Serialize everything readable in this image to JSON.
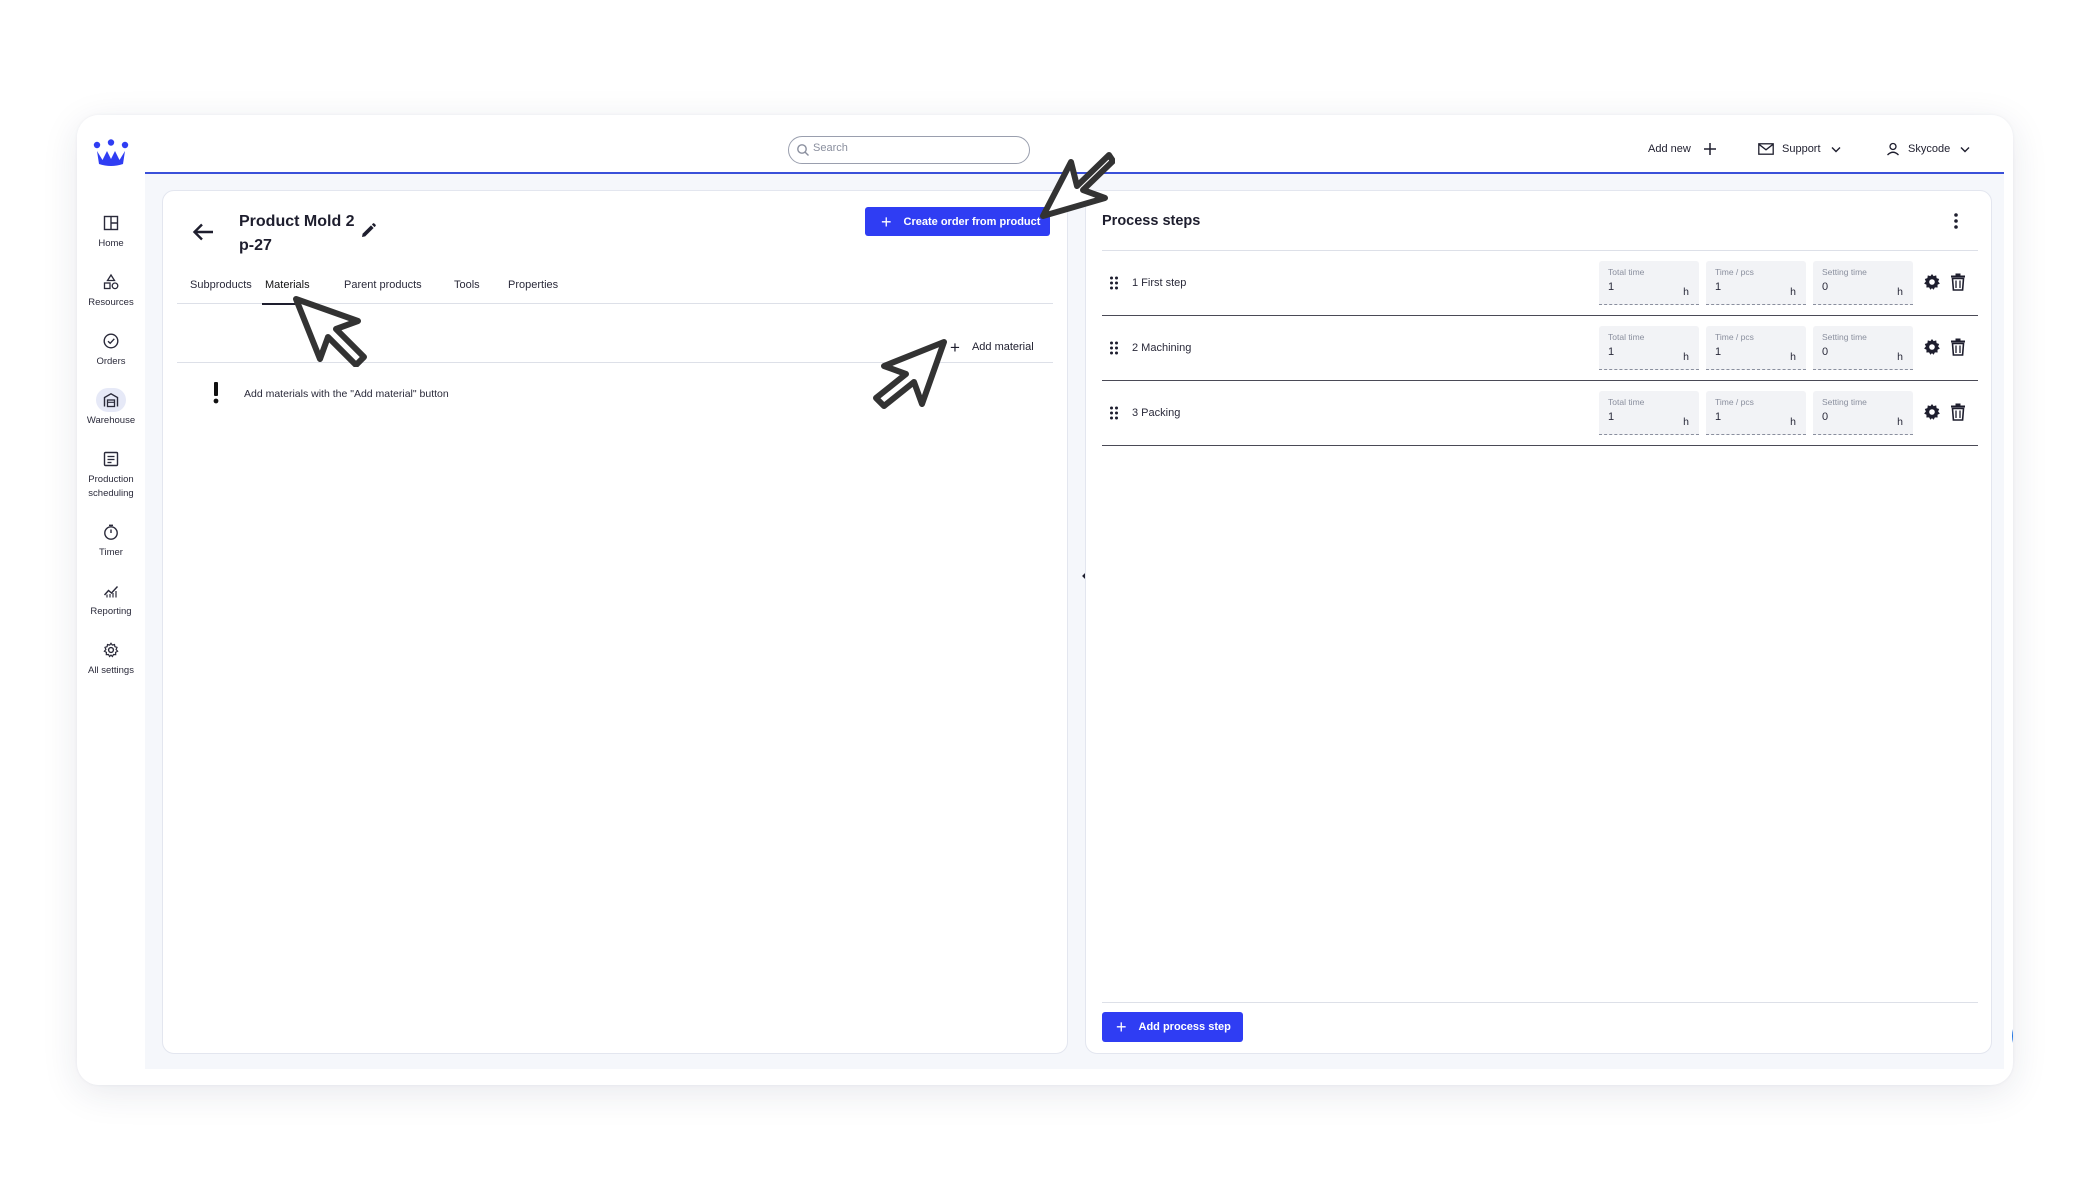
{
  "colors": {
    "accent": "#2f3df3",
    "topbar_border": "#3a50d9",
    "chat": "#2476e2",
    "background": "#f5f7fb"
  },
  "sidebar": {
    "items": [
      {
        "label": "Home",
        "icon": "layout-icon"
      },
      {
        "label": "Resources",
        "icon": "shapes-icon"
      },
      {
        "label": "Orders",
        "icon": "check-circle-icon"
      },
      {
        "label": "Warehouse",
        "icon": "warehouse-icon",
        "active": true
      },
      {
        "label": "Production scheduling",
        "icon": "schedule-icon"
      },
      {
        "label": "Timer",
        "icon": "stopwatch-icon"
      },
      {
        "label": "Reporting",
        "icon": "chart-icon"
      },
      {
        "label": "All settings",
        "icon": "gear-icon"
      }
    ]
  },
  "topbar": {
    "search_placeholder": "Search",
    "add_new": "Add new",
    "support": "Support",
    "user": "Skycode"
  },
  "product": {
    "title": "Product Mold 2",
    "code": "p-27",
    "create_order_label": "Create order from product",
    "tabs": [
      "Subproducts",
      "Materials",
      "Parent products",
      "Tools",
      "Properties"
    ],
    "active_tab": "Materials",
    "add_material_label": "Add material",
    "empty_message": "Add materials with the \"Add material\" button"
  },
  "process": {
    "title": "Process steps",
    "field_labels": {
      "total": "Total time",
      "per_pcs": "Time / pcs",
      "setting": "Setting time"
    },
    "unit": "h",
    "steps": [
      {
        "name": "1 First step",
        "total": "1",
        "per_pcs": "1",
        "setting": "0"
      },
      {
        "name": "2 Machining",
        "total": "1",
        "per_pcs": "1",
        "setting": "0"
      },
      {
        "name": "3 Packing",
        "total": "1",
        "per_pcs": "1",
        "setting": "0"
      }
    ],
    "add_step_label": "Add process step"
  }
}
